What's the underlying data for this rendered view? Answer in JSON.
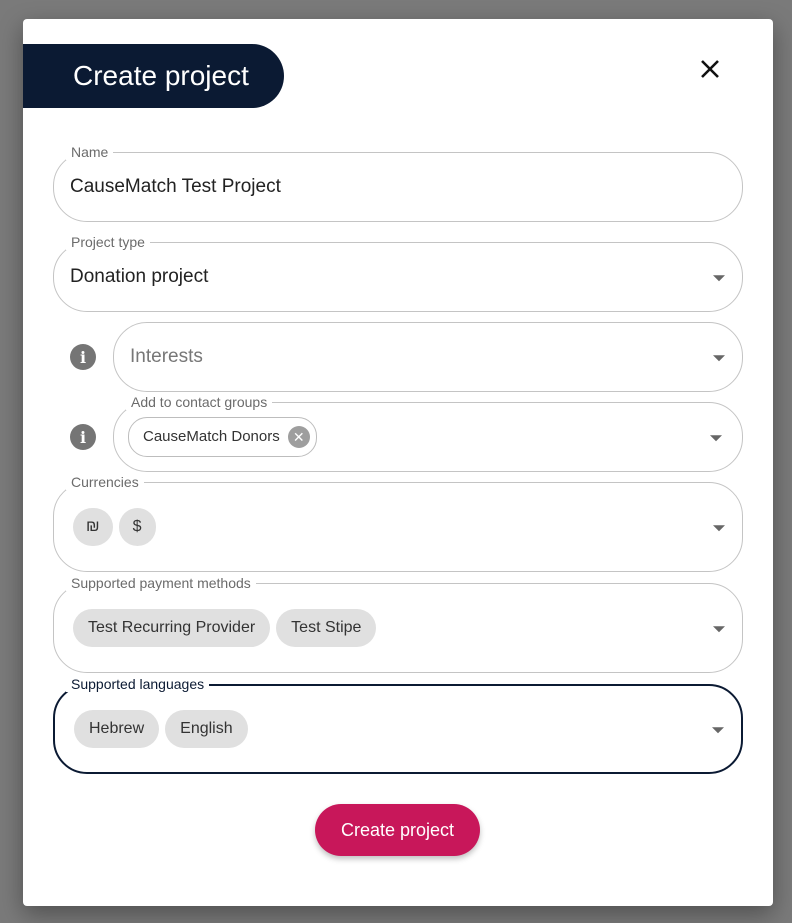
{
  "dialog": {
    "title": "Create project",
    "close_icon": "close-icon"
  },
  "fields": {
    "name": {
      "label": "Name",
      "value": "CauseMatch Test Project"
    },
    "project_type": {
      "label": "Project type",
      "value": "Donation project"
    },
    "interests": {
      "placeholder": "Interests",
      "info_icon": "info-icon"
    },
    "contact_groups": {
      "label": "Add to contact groups",
      "info_icon": "info-icon",
      "chips": [
        "CauseMatch Donors"
      ]
    },
    "currencies": {
      "label": "Currencies",
      "chips": [
        "₪",
        "$"
      ]
    },
    "payment_methods": {
      "label": "Supported payment methods",
      "chips": [
        "Test Recurring Provider",
        "Test Stipe"
      ]
    },
    "languages": {
      "label": "Supported languages",
      "chips": [
        "Hebrew",
        "English"
      ]
    }
  },
  "submit": {
    "label": "Create project"
  },
  "colors": {
    "title_bg": "#0b1a33",
    "accent": "#c8175a",
    "backdrop": "#7a7a7a"
  }
}
